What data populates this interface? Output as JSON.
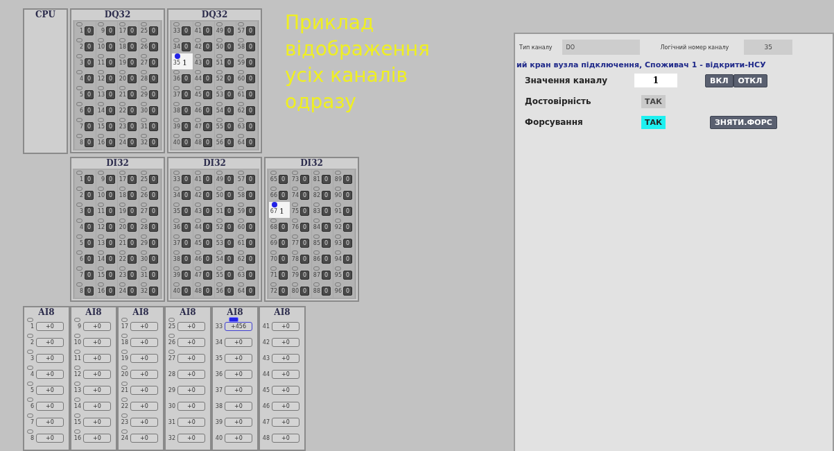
{
  "caption": "Приклад відображення усіх каналів одразу",
  "module_rows": [
    [
      {
        "kind": "cpu",
        "title": "CPU"
      },
      {
        "kind": "digital",
        "title": "DQ32",
        "channels": [
          {
            "number": "1",
            "value": "0",
            "selected": false
          },
          {
            "number": "2",
            "value": "0",
            "selected": false
          },
          {
            "number": "3",
            "value": "0",
            "selected": false
          },
          {
            "number": "4",
            "value": "0",
            "selected": false
          },
          {
            "number": "5",
            "value": "0",
            "selected": false
          },
          {
            "number": "6",
            "value": "0",
            "selected": false
          },
          {
            "number": "7",
            "value": "0",
            "selected": false
          },
          {
            "number": "8",
            "value": "0",
            "selected": false
          },
          {
            "number": "9",
            "value": "0",
            "selected": false
          },
          {
            "number": "10",
            "value": "0",
            "selected": false
          },
          {
            "number": "11",
            "value": "0",
            "selected": false
          },
          {
            "number": "12",
            "value": "0",
            "selected": false
          },
          {
            "number": "13",
            "value": "0",
            "selected": false
          },
          {
            "number": "14",
            "value": "0",
            "selected": false
          },
          {
            "number": "15",
            "value": "0",
            "selected": false
          },
          {
            "number": "16",
            "value": "0",
            "selected": false
          },
          {
            "number": "17",
            "value": "0",
            "selected": false
          },
          {
            "number": "18",
            "value": "0",
            "selected": false
          },
          {
            "number": "19",
            "value": "0",
            "selected": false
          },
          {
            "number": "20",
            "value": "0",
            "selected": false
          },
          {
            "number": "21",
            "value": "0",
            "selected": false
          },
          {
            "number": "22",
            "value": "0",
            "selected": false
          },
          {
            "number": "23",
            "value": "0",
            "selected": false
          },
          {
            "number": "24",
            "value": "0",
            "selected": false
          },
          {
            "number": "25",
            "value": "0",
            "selected": false
          },
          {
            "number": "26",
            "value": "0",
            "selected": false
          },
          {
            "number": "27",
            "value": "0",
            "selected": false
          },
          {
            "number": "28",
            "value": "0",
            "selected": false
          },
          {
            "number": "29",
            "value": "0",
            "selected": false
          },
          {
            "number": "30",
            "value": "0",
            "selected": false
          },
          {
            "number": "31",
            "value": "0",
            "selected": false
          },
          {
            "number": "32",
            "value": "0",
            "selected": false
          }
        ]
      },
      {
        "kind": "digital",
        "title": "DQ32",
        "channels": [
          {
            "number": "33",
            "value": "0",
            "selected": false
          },
          {
            "number": "34",
            "value": "0",
            "selected": false
          },
          {
            "number": "35",
            "value": "1",
            "selected": true
          },
          {
            "number": "36",
            "value": "0",
            "selected": false
          },
          {
            "number": "37",
            "value": "0",
            "selected": false
          },
          {
            "number": "38",
            "value": "0",
            "selected": false
          },
          {
            "number": "39",
            "value": "0",
            "selected": false
          },
          {
            "number": "40",
            "value": "0",
            "selected": false
          },
          {
            "number": "41",
            "value": "0",
            "selected": false
          },
          {
            "number": "42",
            "value": "0",
            "selected": false
          },
          {
            "number": "43",
            "value": "0",
            "selected": false
          },
          {
            "number": "44",
            "value": "0",
            "selected": false
          },
          {
            "number": "45",
            "value": "0",
            "selected": false
          },
          {
            "number": "46",
            "value": "0",
            "selected": false
          },
          {
            "number": "47",
            "value": "0",
            "selected": false
          },
          {
            "number": "48",
            "value": "0",
            "selected": false
          },
          {
            "number": "49",
            "value": "0",
            "selected": false
          },
          {
            "number": "50",
            "value": "0",
            "selected": false
          },
          {
            "number": "51",
            "value": "0",
            "selected": false
          },
          {
            "number": "52",
            "value": "0",
            "selected": false
          },
          {
            "number": "53",
            "value": "0",
            "selected": false
          },
          {
            "number": "54",
            "value": "0",
            "selected": false
          },
          {
            "number": "55",
            "value": "0",
            "selected": false
          },
          {
            "number": "56",
            "value": "0",
            "selected": false
          },
          {
            "number": "57",
            "value": "0",
            "selected": false
          },
          {
            "number": "58",
            "value": "0",
            "selected": false
          },
          {
            "number": "59",
            "value": "0",
            "selected": false
          },
          {
            "number": "60",
            "value": "0",
            "selected": false
          },
          {
            "number": "61",
            "value": "0",
            "selected": false
          },
          {
            "number": "62",
            "value": "0",
            "selected": false
          },
          {
            "number": "63",
            "value": "0",
            "selected": false
          },
          {
            "number": "64",
            "value": "0",
            "selected": false
          }
        ]
      }
    ],
    [
      {
        "kind": "digital",
        "title": "DI32",
        "channels": [
          {
            "number": "1",
            "value": "0",
            "selected": false
          },
          {
            "number": "2",
            "value": "0",
            "selected": false
          },
          {
            "number": "3",
            "value": "0",
            "selected": false
          },
          {
            "number": "4",
            "value": "0",
            "selected": false
          },
          {
            "number": "5",
            "value": "0",
            "selected": false
          },
          {
            "number": "6",
            "value": "0",
            "selected": false
          },
          {
            "number": "7",
            "value": "0",
            "selected": false
          },
          {
            "number": "8",
            "value": "0",
            "selected": false
          },
          {
            "number": "9",
            "value": "0",
            "selected": false
          },
          {
            "number": "10",
            "value": "0",
            "selected": false
          },
          {
            "number": "11",
            "value": "0",
            "selected": false
          },
          {
            "number": "12",
            "value": "0",
            "selected": false
          },
          {
            "number": "13",
            "value": "0",
            "selected": false
          },
          {
            "number": "14",
            "value": "0",
            "selected": false
          },
          {
            "number": "15",
            "value": "0",
            "selected": false
          },
          {
            "number": "16",
            "value": "0",
            "selected": false
          },
          {
            "number": "17",
            "value": "0",
            "selected": false
          },
          {
            "number": "18",
            "value": "0",
            "selected": false
          },
          {
            "number": "19",
            "value": "0",
            "selected": false
          },
          {
            "number": "20",
            "value": "0",
            "selected": false
          },
          {
            "number": "21",
            "value": "0",
            "selected": false
          },
          {
            "number": "22",
            "value": "0",
            "selected": false
          },
          {
            "number": "23",
            "value": "0",
            "selected": false
          },
          {
            "number": "24",
            "value": "0",
            "selected": false
          },
          {
            "number": "25",
            "value": "0",
            "selected": false
          },
          {
            "number": "26",
            "value": "0",
            "selected": false
          },
          {
            "number": "27",
            "value": "0",
            "selected": false
          },
          {
            "number": "28",
            "value": "0",
            "selected": false
          },
          {
            "number": "29",
            "value": "0",
            "selected": false
          },
          {
            "number": "30",
            "value": "0",
            "selected": false
          },
          {
            "number": "31",
            "value": "0",
            "selected": false
          },
          {
            "number": "32",
            "value": "0",
            "selected": false
          }
        ]
      },
      {
        "kind": "digital",
        "title": "DI32",
        "channels": [
          {
            "number": "33",
            "value": "0",
            "selected": false
          },
          {
            "number": "34",
            "value": "0",
            "selected": false
          },
          {
            "number": "35",
            "value": "0",
            "selected": false
          },
          {
            "number": "36",
            "value": "0",
            "selected": false
          },
          {
            "number": "37",
            "value": "0",
            "selected": false
          },
          {
            "number": "38",
            "value": "0",
            "selected": false
          },
          {
            "number": "39",
            "value": "0",
            "selected": false
          },
          {
            "number": "40",
            "value": "0",
            "selected": false
          },
          {
            "number": "41",
            "value": "0",
            "selected": false
          },
          {
            "number": "42",
            "value": "0",
            "selected": false
          },
          {
            "number": "43",
            "value": "0",
            "selected": false
          },
          {
            "number": "44",
            "value": "0",
            "selected": false
          },
          {
            "number": "45",
            "value": "0",
            "selected": false
          },
          {
            "number": "46",
            "value": "0",
            "selected": false
          },
          {
            "number": "47",
            "value": "0",
            "selected": false
          },
          {
            "number": "48",
            "value": "0",
            "selected": false
          },
          {
            "number": "49",
            "value": "0",
            "selected": false
          },
          {
            "number": "50",
            "value": "0",
            "selected": false
          },
          {
            "number": "51",
            "value": "0",
            "selected": false
          },
          {
            "number": "52",
            "value": "0",
            "selected": false
          },
          {
            "number": "53",
            "value": "0",
            "selected": false
          },
          {
            "number": "54",
            "value": "0",
            "selected": false
          },
          {
            "number": "55",
            "value": "0",
            "selected": false
          },
          {
            "number": "56",
            "value": "0",
            "selected": false
          },
          {
            "number": "57",
            "value": "0",
            "selected": false
          },
          {
            "number": "58",
            "value": "0",
            "selected": false
          },
          {
            "number": "59",
            "value": "0",
            "selected": false
          },
          {
            "number": "60",
            "value": "0",
            "selected": false
          },
          {
            "number": "61",
            "value": "0",
            "selected": false
          },
          {
            "number": "62",
            "value": "0",
            "selected": false
          },
          {
            "number": "63",
            "value": "0",
            "selected": false
          },
          {
            "number": "64",
            "value": "0",
            "selected": false
          }
        ]
      },
      {
        "kind": "digital",
        "title": "DI32",
        "channels": [
          {
            "number": "65",
            "value": "0",
            "selected": false
          },
          {
            "number": "66",
            "value": "0",
            "selected": false
          },
          {
            "number": "67",
            "value": "1",
            "selected": true
          },
          {
            "number": "68",
            "value": "0",
            "selected": false
          },
          {
            "number": "69",
            "value": "0",
            "selected": false
          },
          {
            "number": "70",
            "value": "0",
            "selected": false
          },
          {
            "number": "71",
            "value": "0",
            "selected": false
          },
          {
            "number": "72",
            "value": "0",
            "selected": false
          },
          {
            "number": "73",
            "value": "0",
            "selected": false
          },
          {
            "number": "74",
            "value": "0",
            "selected": false
          },
          {
            "number": "75",
            "value": "0",
            "selected": false
          },
          {
            "number": "76",
            "value": "0",
            "selected": false
          },
          {
            "number": "77",
            "value": "0",
            "selected": false
          },
          {
            "number": "78",
            "value": "0",
            "selected": false
          },
          {
            "number": "79",
            "value": "0",
            "selected": false
          },
          {
            "number": "80",
            "value": "0",
            "selected": false
          },
          {
            "number": "81",
            "value": "0",
            "selected": false
          },
          {
            "number": "82",
            "value": "0",
            "selected": false
          },
          {
            "number": "83",
            "value": "0",
            "selected": false
          },
          {
            "number": "84",
            "value": "0",
            "selected": false
          },
          {
            "number": "85",
            "value": "0",
            "selected": false
          },
          {
            "number": "86",
            "value": "0",
            "selected": false
          },
          {
            "number": "87",
            "value": "0",
            "selected": false
          },
          {
            "number": "88",
            "value": "0",
            "selected": false
          },
          {
            "number": "89",
            "value": "0",
            "selected": false
          },
          {
            "number": "90",
            "value": "0",
            "selected": false
          },
          {
            "number": "91",
            "value": "0",
            "selected": false
          },
          {
            "number": "92",
            "value": "0",
            "selected": false
          },
          {
            "number": "93",
            "value": "0",
            "selected": false
          },
          {
            "number": "94",
            "value": "0",
            "selected": false
          },
          {
            "number": "95",
            "value": "0",
            "selected": false
          },
          {
            "number": "96",
            "value": "0",
            "selected": false
          }
        ]
      }
    ],
    [
      {
        "kind": "analog",
        "title": "AI8",
        "channels": [
          {
            "number": "1",
            "value": "+0",
            "selected": false,
            "marker": true
          },
          {
            "number": "2",
            "value": "+0",
            "selected": false,
            "marker": true
          },
          {
            "number": "3",
            "value": "+0",
            "selected": false,
            "marker": true
          },
          {
            "number": "4",
            "value": "+0",
            "selected": false,
            "marker": true
          },
          {
            "number": "5",
            "value": "+0",
            "selected": false,
            "marker": true
          },
          {
            "number": "6",
            "value": "+0",
            "selected": false,
            "marker": true
          },
          {
            "number": "7",
            "value": "+0",
            "selected": false,
            "marker": true
          },
          {
            "number": "8",
            "value": "+0",
            "selected": false,
            "marker": true
          }
        ]
      },
      {
        "kind": "analog",
        "title": "AI8",
        "channels": [
          {
            "number": "9",
            "value": "+0",
            "selected": false,
            "marker": true
          },
          {
            "number": "10",
            "value": "+0",
            "selected": false,
            "marker": true
          },
          {
            "number": "11",
            "value": "+0",
            "selected": false,
            "marker": true
          },
          {
            "number": "12",
            "value": "+0",
            "selected": false,
            "marker": true
          },
          {
            "number": "13",
            "value": "+0",
            "selected": false,
            "marker": true
          },
          {
            "number": "14",
            "value": "+0",
            "selected": false,
            "marker": true
          },
          {
            "number": "15",
            "value": "+0",
            "selected": false,
            "marker": true
          },
          {
            "number": "16",
            "value": "+0",
            "selected": false,
            "marker": true
          }
        ]
      },
      {
        "kind": "analog",
        "title": "AI8",
        "channels": [
          {
            "number": "17",
            "value": "+0",
            "selected": false,
            "marker": true
          },
          {
            "number": "18",
            "value": "+0",
            "selected": false,
            "marker": true
          },
          {
            "number": "19",
            "value": "+0",
            "selected": false,
            "marker": true
          },
          {
            "number": "20",
            "value": "+0",
            "selected": false,
            "marker": true
          },
          {
            "number": "21",
            "value": "+0",
            "selected": false,
            "marker": true
          },
          {
            "number": "22",
            "value": "+0",
            "selected": false,
            "marker": true
          },
          {
            "number": "23",
            "value": "+0",
            "selected": false,
            "marker": true
          },
          {
            "number": "24",
            "value": "+0",
            "selected": false,
            "marker": true
          }
        ]
      },
      {
        "kind": "analog",
        "title": "AI8",
        "channels": [
          {
            "number": "25",
            "value": "+0",
            "selected": false,
            "marker": true
          },
          {
            "number": "26",
            "value": "+0",
            "selected": false,
            "marker": true
          },
          {
            "number": "27",
            "value": "+0",
            "selected": false,
            "marker": true
          },
          {
            "number": "28",
            "value": "+0",
            "selected": false,
            "marker": false
          },
          {
            "number": "29",
            "value": "+0",
            "selected": false,
            "marker": false
          },
          {
            "number": "30",
            "value": "+0",
            "selected": false,
            "marker": false
          },
          {
            "number": "31",
            "value": "+0",
            "selected": false,
            "marker": false
          },
          {
            "number": "32",
            "value": "+0",
            "selected": false,
            "marker": false
          }
        ]
      },
      {
        "kind": "analog",
        "title": "AI8",
        "channels": [
          {
            "number": "33",
            "value": "+456",
            "selected": true
          },
          {
            "number": "34",
            "value": "+0",
            "selected": false,
            "marker": false
          },
          {
            "number": "35",
            "value": "+0",
            "selected": false,
            "marker": false
          },
          {
            "number": "36",
            "value": "+0",
            "selected": false,
            "marker": false
          },
          {
            "number": "37",
            "value": "+0",
            "selected": false,
            "marker": false
          },
          {
            "number": "38",
            "value": "+0",
            "selected": false,
            "marker": false
          },
          {
            "number": "39",
            "value": "+0",
            "selected": false,
            "marker": false
          },
          {
            "number": "40",
            "value": "+0",
            "selected": false,
            "marker": false
          }
        ]
      },
      {
        "kind": "analog",
        "title": "AI8",
        "channels": [
          {
            "number": "41",
            "value": "+0",
            "selected": false,
            "marker": false
          },
          {
            "number": "42",
            "value": "+0",
            "selected": false,
            "marker": false
          },
          {
            "number": "43",
            "value": "+0",
            "selected": false,
            "marker": false
          },
          {
            "number": "44",
            "value": "+0",
            "selected": false,
            "marker": false
          },
          {
            "number": "45",
            "value": "+0",
            "selected": false,
            "marker": false
          },
          {
            "number": "46",
            "value": "+0",
            "selected": false,
            "marker": false
          },
          {
            "number": "47",
            "value": "+0",
            "selected": false,
            "marker": false
          },
          {
            "number": "48",
            "value": "+0",
            "selected": false,
            "marker": false
          }
        ]
      }
    ]
  ],
  "detail": {
    "type_label": "Тип каналу",
    "type_value": "DO",
    "number_label": "Логічний номер каналу",
    "number_value": "35",
    "description": "ий кран вузла підключення, Споживач 1 - відкрити-НСУ",
    "value_label": "Значення каналу",
    "value": "1",
    "on_button": "ВКЛ",
    "off_button": "ОТКЛ",
    "validity_label": "Достовірність",
    "validity": {
      "text": "ТАК",
      "on": false
    },
    "forcing_label": "Форсування",
    "forcing": {
      "text": "ТАК",
      "on": true
    },
    "unforce_button": "ЗНЯТИ.ФОРС"
  }
}
